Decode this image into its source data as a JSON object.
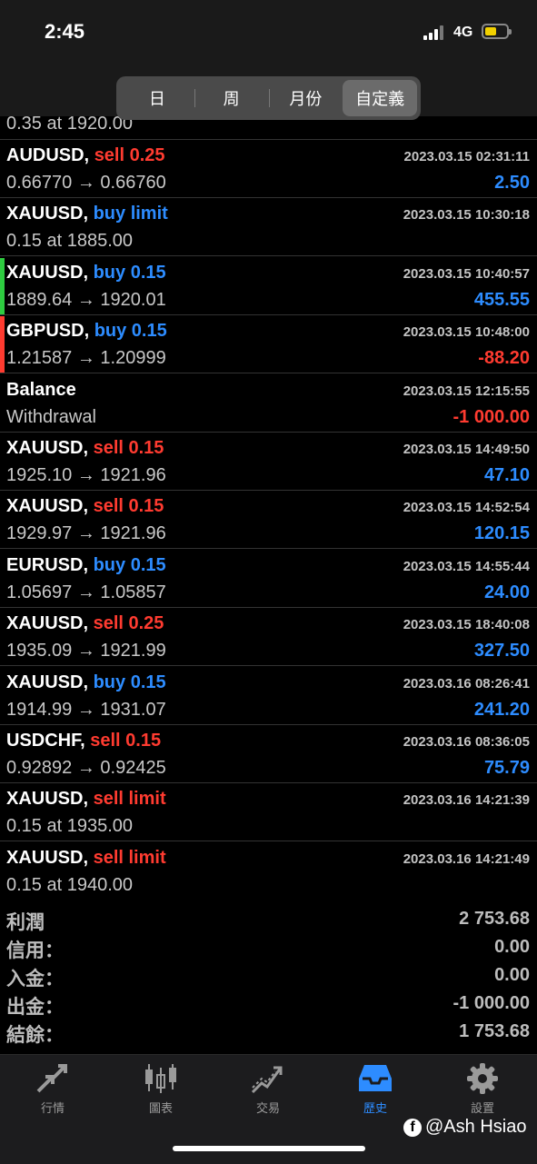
{
  "status": {
    "time": "2:45",
    "network": "4G"
  },
  "tabs_top": [
    "日",
    "周",
    "月份",
    "自定義"
  ],
  "partial_row": {
    "desc": "0.35 at 1920.00"
  },
  "rows": [
    {
      "symbol": "AUDUSD,",
      "action": "sell 0.25",
      "action_color": "red",
      "desc": "0.66770 → 0.66760",
      "date": "2023.03.15 02:31:11",
      "profit": "2.50",
      "profit_color": "blue",
      "marker": ""
    },
    {
      "symbol": "XAUUSD,",
      "action": "buy limit",
      "action_color": "blue",
      "desc": "0.15 at 1885.00",
      "date": "2023.03.15 10:30:18",
      "profit": "",
      "profit_color": "blue",
      "marker": ""
    },
    {
      "symbol": "XAUUSD,",
      "action": "buy 0.15",
      "action_color": "blue",
      "desc": "1889.64 → 1920.01",
      "date": "2023.03.15 10:40:57",
      "profit": "455.55",
      "profit_color": "blue",
      "marker": "#2ecc40"
    },
    {
      "symbol": "GBPUSD,",
      "action": "buy 0.15",
      "action_color": "blue",
      "desc": "1.21587 → 1.20999",
      "date": "2023.03.15 10:48:00",
      "profit": "-88.20",
      "profit_color": "red",
      "marker": "#ff3b30"
    },
    {
      "symbol": "Balance",
      "action": "",
      "action_color": "blue",
      "desc": "Withdrawal",
      "date": "2023.03.15 12:15:55",
      "profit": "-1 000.00",
      "profit_color": "red",
      "marker": ""
    },
    {
      "symbol": "XAUUSD,",
      "action": "sell 0.15",
      "action_color": "red",
      "desc": "1925.10 → 1921.96",
      "date": "2023.03.15 14:49:50",
      "profit": "47.10",
      "profit_color": "blue",
      "marker": ""
    },
    {
      "symbol": "XAUUSD,",
      "action": "sell 0.15",
      "action_color": "red",
      "desc": "1929.97 → 1921.96",
      "date": "2023.03.15 14:52:54",
      "profit": "120.15",
      "profit_color": "blue",
      "marker": ""
    },
    {
      "symbol": "EURUSD,",
      "action": "buy 0.15",
      "action_color": "blue",
      "desc": "1.05697 → 1.05857",
      "date": "2023.03.15 14:55:44",
      "profit": "24.00",
      "profit_color": "blue",
      "marker": ""
    },
    {
      "symbol": "XAUUSD,",
      "action": "sell 0.25",
      "action_color": "red",
      "desc": "1935.09 → 1921.99",
      "date": "2023.03.15 18:40:08",
      "profit": "327.50",
      "profit_color": "blue",
      "marker": ""
    },
    {
      "symbol": "XAUUSD,",
      "action": "buy 0.15",
      "action_color": "blue",
      "desc": "1914.99 → 1931.07",
      "date": "2023.03.16 08:26:41",
      "profit": "241.20",
      "profit_color": "blue",
      "marker": ""
    },
    {
      "symbol": "USDCHF,",
      "action": "sell 0.15",
      "action_color": "red",
      "desc": "0.92892 → 0.92425",
      "date": "2023.03.16 08:36:05",
      "profit": "75.79",
      "profit_color": "blue",
      "marker": ""
    },
    {
      "symbol": "XAUUSD,",
      "action": "sell limit",
      "action_color": "red",
      "desc": "0.15 at 1935.00",
      "date": "2023.03.16 14:21:39",
      "profit": "",
      "profit_color": "blue",
      "marker": ""
    },
    {
      "symbol": "XAUUSD,",
      "action": "sell limit",
      "action_color": "red",
      "desc": "0.15 at 1940.00",
      "date": "2023.03.16 14:21:49",
      "profit": "",
      "profit_color": "blue",
      "marker": ""
    }
  ],
  "summary": [
    {
      "label": "利潤",
      "value": "2 753.68"
    },
    {
      "label": "信用：",
      "value": "0.00"
    },
    {
      "label": "入金：",
      "value": "0.00"
    },
    {
      "label": "出金：",
      "value": "-1 000.00"
    },
    {
      "label": "結餘：",
      "value": "1 753.68"
    }
  ],
  "tabbar": [
    {
      "label": "行情",
      "icon": "quotes-arrows-icon",
      "active": false
    },
    {
      "label": "圖表",
      "icon": "candlestick-chart-icon",
      "active": false
    },
    {
      "label": "交易",
      "icon": "trade-trend-icon",
      "active": false
    },
    {
      "label": "歷史",
      "icon": "history-inbox-icon",
      "active": true
    },
    {
      "label": "設置",
      "icon": "gear-icon",
      "active": false
    }
  ],
  "watermark": "@Ash Hsiao",
  "colors": {
    "blue": "#2d8cff",
    "red": "#ff3b30",
    "green_marker": "#2ecc40"
  }
}
